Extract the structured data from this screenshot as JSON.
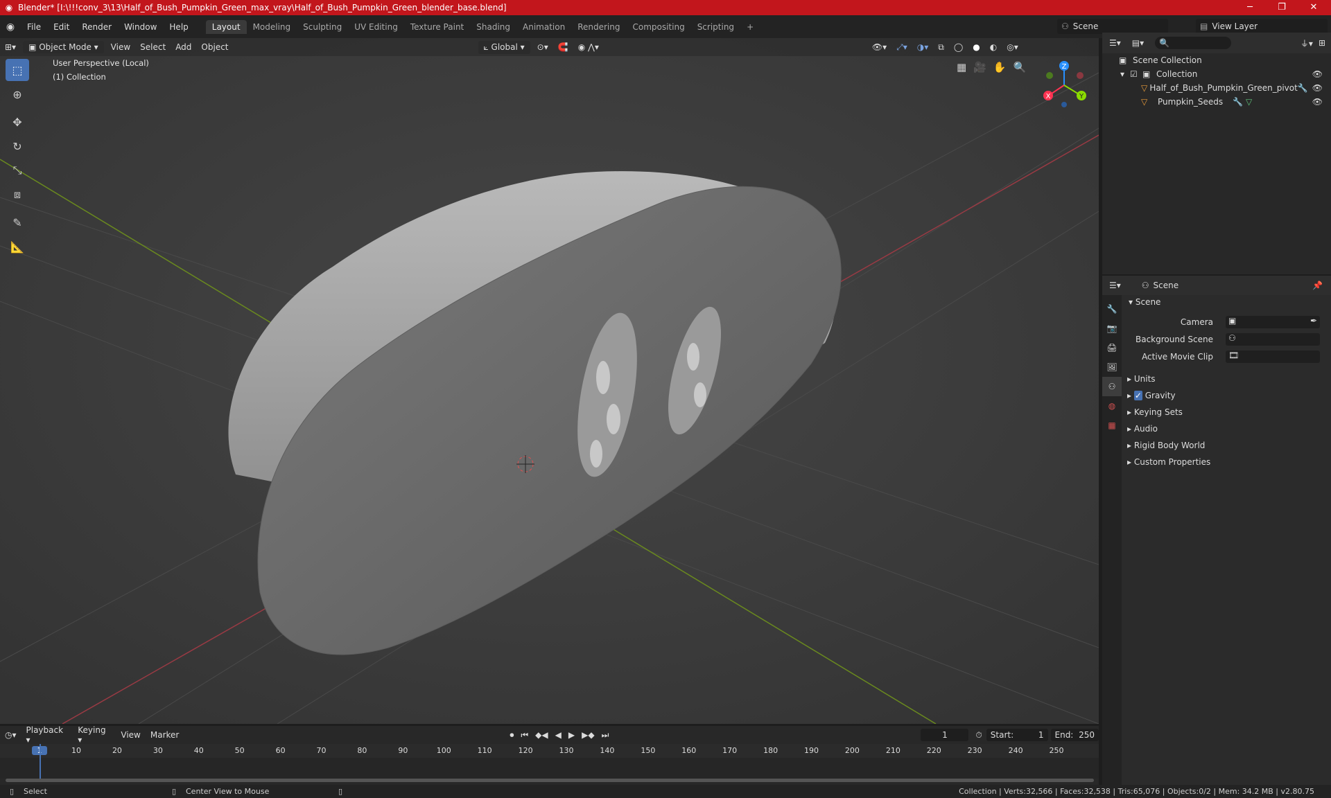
{
  "window": {
    "title": "Blender* [I:\\!!!conv_3\\13\\Half_of_Bush_Pumpkin_Green_max_vray\\Half_of_Bush_Pumpkin_Green_blender_base.blend]",
    "title_bar_color": "#c2161c"
  },
  "menu": {
    "items": [
      "File",
      "Edit",
      "Render",
      "Window",
      "Help"
    ],
    "workspaces": [
      "Layout",
      "Modeling",
      "Sculpting",
      "UV Editing",
      "Texture Paint",
      "Shading",
      "Animation",
      "Rendering",
      "Compositing",
      "Scripting"
    ],
    "active_workspace": "Layout",
    "scene": "Scene",
    "view_layer": "View Layer"
  },
  "viewport": {
    "mode": "Object Mode",
    "menus": [
      "View",
      "Select",
      "Add",
      "Object"
    ],
    "transform_orientation": "Global",
    "overlay_title": "User Perspective (Local)",
    "overlay_collection": "(1) Collection",
    "gizmo_axes": [
      "Z",
      "X",
      "Y"
    ],
    "axis_colors": {
      "x": "#ff3352",
      "y": "#8bdc00",
      "z": "#2890ff"
    },
    "accent": "#4772b3"
  },
  "outliner": {
    "root": "Scene Collection",
    "collection": "Collection",
    "objects": [
      "Half_of_Bush_Pumpkin_Green_pivot",
      "Pumpkin_Seeds"
    ],
    "search_placeholder": ""
  },
  "properties": {
    "header": "Scene",
    "section": "Scene",
    "fields": [
      {
        "label": "Camera",
        "value": ""
      },
      {
        "label": "Background Scene",
        "value": ""
      },
      {
        "label": "Active Movie Clip",
        "value": ""
      }
    ],
    "panels": [
      "Units",
      "Gravity",
      "Keying Sets",
      "Audio",
      "Rigid Body World",
      "Custom Properties"
    ],
    "gravity_checked": true
  },
  "timeline": {
    "menus": [
      "Playback",
      "Keying",
      "View",
      "Marker"
    ],
    "current_frame": "1",
    "start_label": "Start:",
    "start": "1",
    "end_label": "End:",
    "end": "250",
    "ticks": [
      "1",
      "10",
      "20",
      "30",
      "40",
      "50",
      "60",
      "70",
      "80",
      "90",
      "100",
      "110",
      "120",
      "130",
      "140",
      "150",
      "160",
      "170",
      "180",
      "190",
      "200",
      "210",
      "220",
      "230",
      "240",
      "250"
    ]
  },
  "statusbar": {
    "left_action": "Select",
    "middle_action": "Center View to Mouse",
    "stats": "Collection | Verts:32,566 | Faces:32,538 | Tris:65,076 | Objects:0/2 | Mem: 34.2 MB | v2.80.75"
  }
}
